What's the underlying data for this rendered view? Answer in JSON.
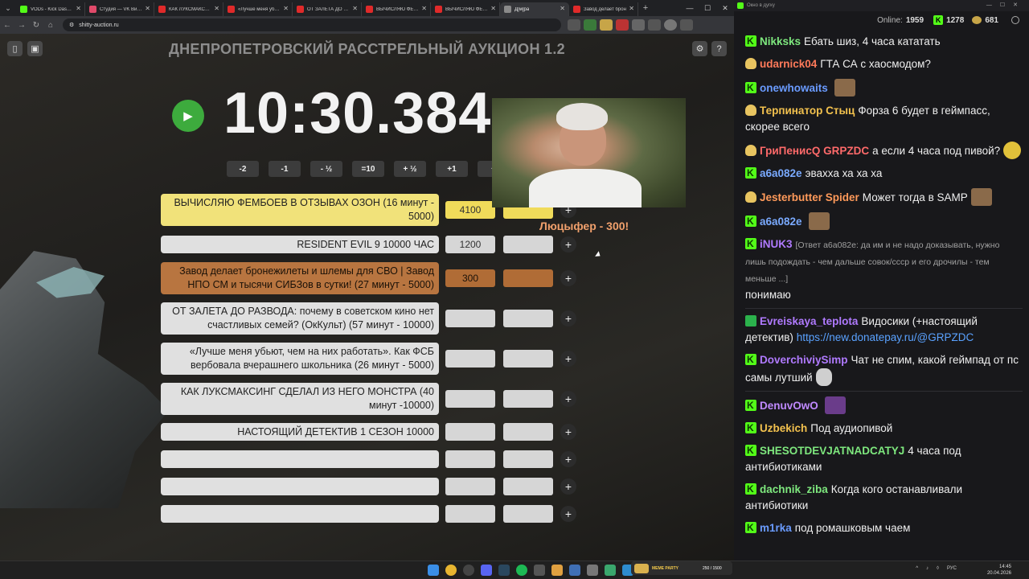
{
  "browser": {
    "tabs": [
      {
        "label": "VODs - Kick Dashbo",
        "color": "#53fc18"
      },
      {
        "label": "Студия — VK Видео",
        "color": "#e04a6a"
      },
      {
        "label": "КАК ЛУКСМАКСИНГ",
        "color": "#e02a2a"
      },
      {
        "label": "«Лучше меня убьют",
        "color": "#e02a2a"
      },
      {
        "label": "ОТ ЗАЛЕТА ДО РАЗ",
        "color": "#e02a2a"
      },
      {
        "label": "ВЫЧИСЛЯЮ ФЕМБ",
        "color": "#e02a2a"
      },
      {
        "label": "ВЫЧИСЛЯЮ ФЕМБ",
        "color": "#e02a2a"
      },
      {
        "label": "Д[м]ра",
        "color": "#8a8a8a",
        "active": true
      },
      {
        "label": "Завод делает брон",
        "color": "#e02a2a"
      }
    ],
    "url": "shitty-auction.ru"
  },
  "auction": {
    "title": "ДНЕПРОПЕТРОВСКИЙ РАССТРЕЛЬНЫЙ АУКЦИОН 1.2",
    "timer": "10:30.384",
    "steps": [
      "-2",
      "-1",
      "- ½",
      "=10",
      "+ ½",
      "+1",
      "+"
    ],
    "lots": [
      {
        "name": "ВЫЧИСЛЯЮ ФЕМБОЕВ В ОТЗЫВАХ ОЗОН (16 минут - 5000)",
        "amount": "4100",
        "style": "gold"
      },
      {
        "name": "RESIDENT EVIL 9 10000 ЧАС",
        "amount": "1200",
        "style": ""
      },
      {
        "name": "Завод делает бронежилеты и шлемы для СВО | Завод НПО СМ и тысячи СИБЗов в сутки! (27 минут - 5000)",
        "amount": "300",
        "style": "brown"
      },
      {
        "name": "ОТ ЗАЛЕТА ДО РАЗВОДА: почему в советском кино нет счастливых семей? (ОкКульт) (57 минут - 10000)",
        "amount": "",
        "style": ""
      },
      {
        "name": "«Лучше меня убьют, чем на них работать». Как ФСБ вербовала вчерашнего школьника (26 минут - 5000)",
        "amount": "",
        "style": ""
      },
      {
        "name": "КАК ЛУКСМАКСИНГ СДЕЛАЛ ИЗ НЕГО МОНСТРА (40 минут -10000)",
        "amount": "",
        "style": ""
      },
      {
        "name": "НАСТОЯЩИЙ ДЕТЕКТИВ 1 СЕЗОН 10000",
        "amount": "",
        "style": ""
      },
      {
        "name": "",
        "amount": "",
        "style": ""
      },
      {
        "name": "",
        "amount": "",
        "style": ""
      },
      {
        "name": "",
        "amount": "",
        "style": ""
      }
    ],
    "donation": "Люцыфер - 300!"
  },
  "chat": {
    "window_title": "Окно в дугку",
    "online_label": "Online:",
    "online": "1959",
    "followers": "1278",
    "coins": "681",
    "messages": [
      {
        "badge": "kick",
        "user": "Nikksks",
        "color": "#7ee87e",
        "text": "Ебать шиз, 4 часа кататать"
      },
      {
        "badge": "sub",
        "user": "udarnick04",
        "color": "#ff7a5a",
        "text": "ГТА СА с хаосмодом?"
      },
      {
        "badge": "kick",
        "user": "onewhowaits",
        "color": "#6a9bff",
        "text": "",
        "emote": "e"
      },
      {
        "badge": "sub",
        "user": "Терпинатор Стыц",
        "color": "#f2c14e",
        "text": "Форза 6 будет в геймпасс, скорее всего"
      },
      {
        "badge": "sub",
        "user": "ГриПенисQ GRPZDC",
        "color": "#ff6a6a",
        "text": "а если 4 часа под пивой?",
        "emote": "y"
      },
      {
        "badge": "kick",
        "user": "a6a082e",
        "color": "#7aaaff",
        "text": "эвахха ха ха ха"
      },
      {
        "badge": "sub",
        "user": "Jesterbutter Spider",
        "color": "#ff9a5a",
        "text": "Может тогда в SAMP",
        "emote": "e"
      },
      {
        "badge": "kick",
        "user": "a6a082e",
        "color": "#7aaaff",
        "text": "",
        "emote": "e"
      },
      {
        "badge": "kick",
        "user": "iNUK3",
        "color": "#b07aff",
        "reply": "[Ответ a6a082e: да им и не надо доказывать, нужно лишь подождать - чем дальше совок/ссср и его дрочилы - тем меньше ...]",
        "text": "понимаю"
      },
      {
        "badge": "mod",
        "user": "Evreiskaya_teplota",
        "color": "#b07aff",
        "text": "Видосики (+настоящий детектив)",
        "link": "https://new.donatepay.ru/@GRPZDC"
      },
      {
        "badge": "kick",
        "user": "DoverchiviySimp",
        "color": "#b07aff",
        "text": "Чат не спим, какой геймпад от пс самы лутший",
        "emote": "g"
      },
      {
        "badge": "kick",
        "user": "DenuvOwO",
        "color": "#c08aff",
        "text": "",
        "emote": "p"
      },
      {
        "badge": "kick",
        "user": "Uzbekich",
        "color": "#f2c14e",
        "text": "Под аудиопивой"
      },
      {
        "badge": "kick",
        "user": "SHESOTDEVJATNADCATYJ",
        "color": "#7ee87e",
        "text": "4 часа под антибиотиками"
      },
      {
        "badge": "kick",
        "user": "dachnik_ziba",
        "color": "#7ee87e",
        "text": "Когда кого останавливали антибиотики"
      },
      {
        "badge": "kick",
        "user": "m1rka",
        "color": "#6a9bff",
        "text": "под ромашковым чаем"
      }
    ]
  },
  "taskbar": {
    "widget_name": "MEME PARTY",
    "widget_count": "250 / 1500",
    "lang": "РУС",
    "time": "14:45",
    "date": "20.04.2026"
  }
}
